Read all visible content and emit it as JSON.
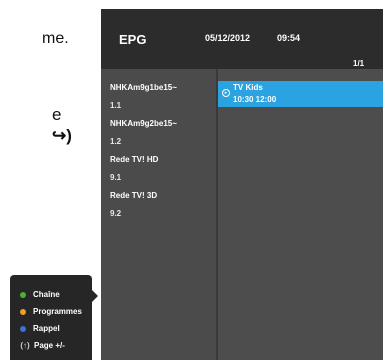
{
  "manual_text": {
    "line1": "me.",
    "line2": "e",
    "line3": "↪)"
  },
  "legend": {
    "items": [
      {
        "label": "Chaîne",
        "color": "#4caf32"
      },
      {
        "label": "Programmes",
        "color": "#f0a020"
      },
      {
        "label": "Rappel",
        "color": "#3a72d8"
      },
      {
        "label": "Page +/-",
        "glyph": "(↑)"
      }
    ]
  },
  "epg": {
    "title": "EPG",
    "date": "05/12/2012",
    "time": "09:54",
    "page": "1/1",
    "channels": [
      {
        "name": "NHKAm9g1be15~",
        "number": "1.1"
      },
      {
        "name": "NHKAm9g2be15~",
        "number": "1.2"
      },
      {
        "name": "Rede TV! HD",
        "number": "9.1"
      },
      {
        "name": "Rede TV! 3D",
        "number": "9.2"
      }
    ],
    "program": {
      "icon": "play-icon",
      "title": "TV Kids",
      "time": "10:30  12:00",
      "highlight_color": "#2aa3e0"
    }
  }
}
